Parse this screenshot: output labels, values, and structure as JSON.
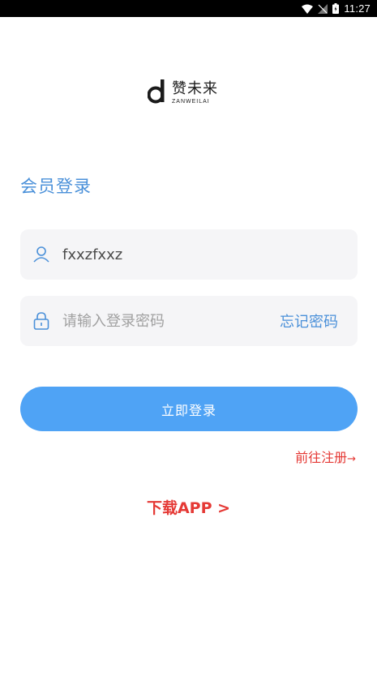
{
  "status_bar": {
    "time": "11:27",
    "icons": [
      "wifi-icon",
      "no-signal-icon",
      "battery-icon"
    ]
  },
  "logo": {
    "mark": "d",
    "text_cn": "赞未来",
    "text_en": "ZANWEILAI"
  },
  "page": {
    "title": "会员登录"
  },
  "form": {
    "username": {
      "value": "fxxzfxxz",
      "icon": "user-icon"
    },
    "password": {
      "value": "",
      "placeholder": "请输入登录密码",
      "icon": "lock-icon"
    },
    "forgot_label": "忘记密码",
    "submit_label": "立即登录"
  },
  "links": {
    "register_label": "前往注册",
    "register_arrow": "→",
    "download_label": "下载APP >"
  },
  "colors": {
    "accent_blue": "#4fa3f5",
    "title_blue": "#4a90d9",
    "link_red": "#e53935",
    "field_bg": "#f5f5f7"
  }
}
